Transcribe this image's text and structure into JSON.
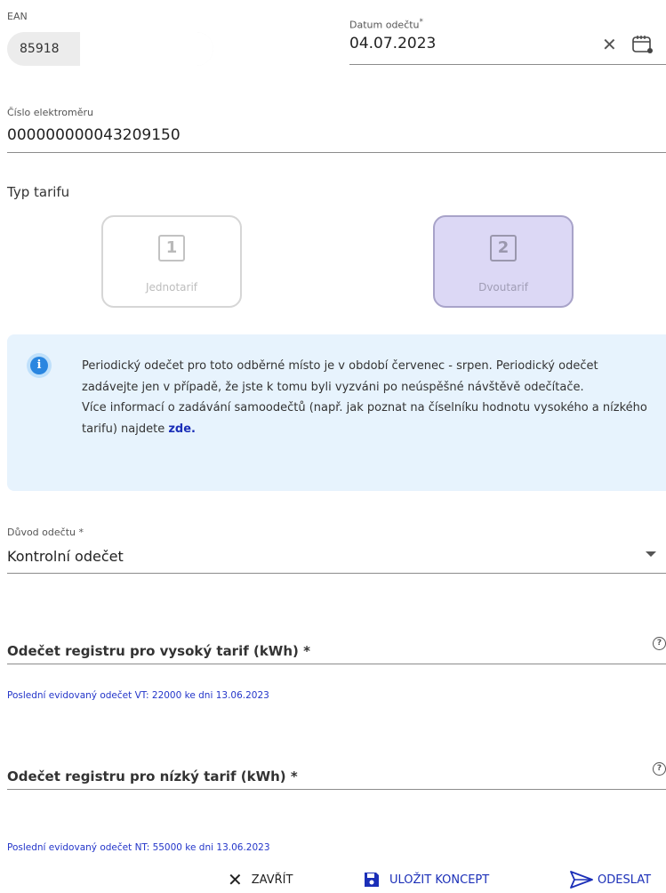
{
  "ean": {
    "label": "EAN",
    "value": "85918"
  },
  "date": {
    "label": "Datum odečtu",
    "required_mark": "*",
    "value": "04.07.2023"
  },
  "meter": {
    "label": "Číslo elektroměru",
    "value": "000000000043209150"
  },
  "tariff": {
    "label": "Typ tarifu",
    "options": [
      {
        "num": "1",
        "name": "Jednotarif",
        "selected": false
      },
      {
        "num": "2",
        "name": "Dvoutarif",
        "selected": true
      }
    ]
  },
  "info": {
    "line1": "Periodický odečet pro toto odběrné místo je v období červenec - srpen. Periodický odečet zadávejte jen v případě, že jste k tomu byli vyzváni po neúspěšné návštěvě odečítače.",
    "line2": "Více informací o zadávání samoodečtů (např. jak poznat na číselníku hodnotu vysokého a nízkého tarifu) najdete",
    "link": "zde."
  },
  "reason": {
    "label": "Důvod odečtu *",
    "value": "Kontrolní odečet"
  },
  "high_tariff": {
    "label": "Odečet registru pro vysoký tarif (kWh) *",
    "hint": "Poslední evidovaný odečet VT: 22000 ke dni 13.06.2023"
  },
  "low_tariff": {
    "label": "Odečet registru pro nízký tarif (kWh) *",
    "hint": "Poslední evidovaný odečet NT: 55000 ke dni 13.06.2023"
  },
  "actions": {
    "close": "ZAVŘÍT",
    "save": "ULOŽIT KONCEPT",
    "send": "ODESLAT"
  },
  "colors": {
    "accent": "#1b2fb8",
    "info_bg": "#e7f3fd",
    "selected_card": "#dcd8f5"
  }
}
